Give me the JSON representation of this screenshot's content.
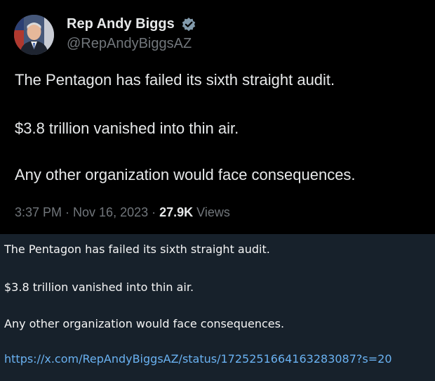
{
  "tweet": {
    "display_name": "Rep Andy Biggs",
    "handle": "@RepAndyBiggsAZ",
    "lines": [
      "The Pentagon has failed its sixth straight audit.",
      "$3.8 trillion vanished into thin air.",
      "Any other organization would face consequences."
    ],
    "timestamp": "3:37 PM · Nov 16, 2023 · ",
    "views_count": "27.9K",
    "views_label": " Views"
  },
  "caption": {
    "lines": [
      "The Pentagon has failed its sixth straight audit.",
      "$3.8 trillion vanished into thin air.",
      "Any other organization would face consequences."
    ],
    "link": "https://x.com/RepAndyBiggsAZ/status/1725251664163283087?s=20"
  },
  "colors": {
    "tweet_background": "#000000",
    "chat_background": "#17212b",
    "verified_badge": "#829aab",
    "link": "#6ab2f2"
  },
  "icons": [
    "avatar-photo",
    "verified-badge-icon"
  ]
}
